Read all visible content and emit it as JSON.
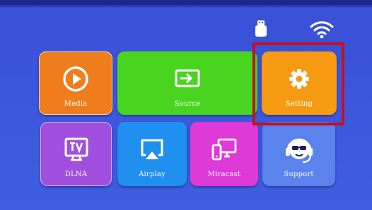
{
  "tiles": {
    "media": {
      "label": "Media",
      "icon": "play-icon",
      "color": "#f07d1b"
    },
    "source": {
      "label": "Source",
      "icon": "input-source-icon",
      "color": "#49d41f"
    },
    "setting": {
      "label": "Setting",
      "icon": "gear-icon",
      "color": "#f69a12"
    },
    "dlna": {
      "label": "DLNA",
      "icon": "tv-icon",
      "color": "#a14fde"
    },
    "airplay": {
      "label": "Airplay",
      "icon": "airplay-icon",
      "color": "#1f8ff0"
    },
    "miracast": {
      "label": "Miracast",
      "icon": "screen-cast-icon",
      "color": "#df39d7"
    },
    "support": {
      "label": "Support",
      "icon": "headset-support-icon",
      "color": "#5a83ee"
    }
  },
  "status": {
    "usb": "usb-icon",
    "wifi": "wifi-icon"
  },
  "selection": {
    "target": "setting",
    "color": "#c4121c"
  }
}
